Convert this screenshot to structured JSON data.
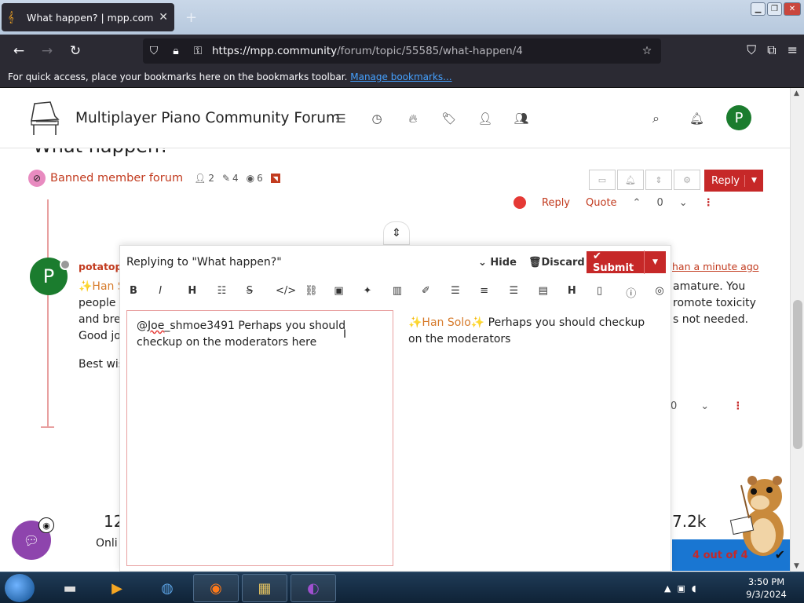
{
  "browser": {
    "tab_title": "What happen? | mpp.communi",
    "url_host": "https://mpp.community",
    "url_path": "/forum/topic/55585/what-happen/4",
    "bookmarks_text": "For quick access, place your bookmarks here on the bookmarks toolbar.",
    "bookmarks_link": "Manage bookmarks..."
  },
  "header": {
    "site_title": "Multiplayer Piano Community Forum",
    "avatar_letter": "P"
  },
  "topic": {
    "title": "What happen?",
    "category": "Banned member forum",
    "posters": "2",
    "posts": "4",
    "views": "6",
    "reply_label": "Reply"
  },
  "prev_post": {
    "reply": "Reply",
    "quote": "Quote",
    "votes": "0"
  },
  "post": {
    "avatar_letter": "P",
    "username": "potatope",
    "time": "han a minute ago",
    "line1_start": "✨Han S",
    "line1_end": "amature. You",
    "line2_start": "people a",
    "line2_end": "romote toxicity",
    "line3_start": "and bre",
    "line3_end": "s not needed.",
    "line4_start": "Good jo",
    "line5_start": "Best wis",
    "votes": "0"
  },
  "stats": {
    "left_number": "12",
    "left_label": "Onli",
    "right_number": "7.2k",
    "progress": "4 out of 4"
  },
  "composer": {
    "title": "Replying to \"What happen?\"",
    "hide": "Hide",
    "discard": "Discard",
    "submit": "Submit",
    "editor_mention": "@",
    "editor_squiggle": "Joe",
    "editor_text_rest": "_shmoe3491 Perhaps you should checkup on the moderators here",
    "preview_han": "✨Han Solo✨",
    "preview_text": " Perhaps you should checkup on the moderators"
  },
  "taskbar": {
    "time": "3:50 PM",
    "date": "9/3/2024"
  }
}
